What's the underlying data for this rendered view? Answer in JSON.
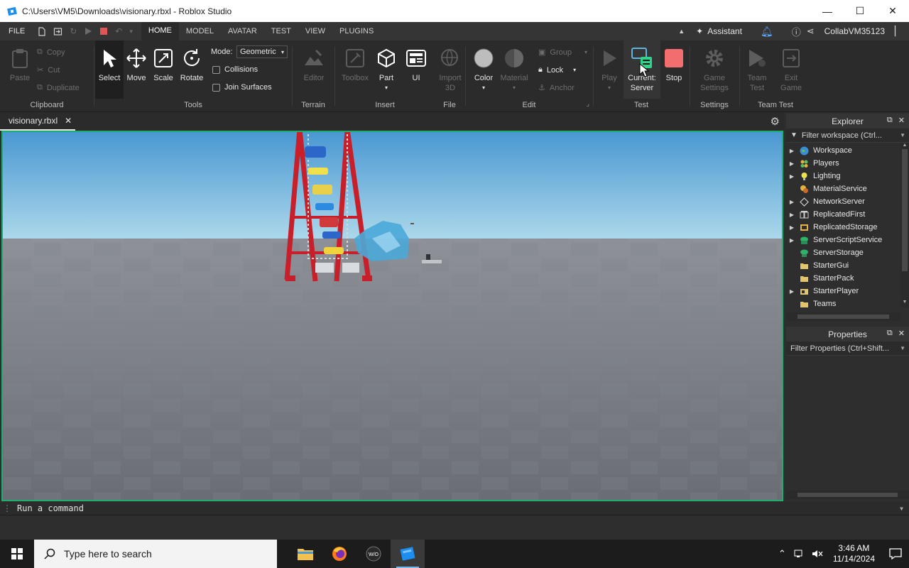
{
  "window": {
    "title": "C:\\Users\\VM5\\Downloads\\visionary.rbxl - Roblox Studio",
    "minimize": "—",
    "maximize": "☐",
    "close": "✕"
  },
  "menu": {
    "file": "FILE",
    "tabs": [
      "HOME",
      "MODEL",
      "AVATAR",
      "TEST",
      "VIEW",
      "PLUGINS"
    ],
    "active_tab": "HOME",
    "assistant": "Assistant",
    "user": "CollabVM35123"
  },
  "ribbon": {
    "clipboard": {
      "label": "Clipboard",
      "paste": "Paste",
      "copy": "Copy",
      "cut": "Cut",
      "duplicate": "Duplicate"
    },
    "tools": {
      "label": "Tools",
      "select": "Select",
      "move": "Move",
      "scale": "Scale",
      "rotate": "Rotate",
      "mode_label": "Mode:",
      "mode_value": "Geometric",
      "collisions": "Collisions",
      "join_surfaces": "Join Surfaces"
    },
    "terrain": {
      "label": "Terrain",
      "editor": "Editor"
    },
    "insert": {
      "label": "Insert",
      "toolbox": "Toolbox",
      "part": "Part",
      "ui": "UI"
    },
    "file": {
      "label": "File",
      "import3d_1": "Import",
      "import3d_2": "3D"
    },
    "edit": {
      "label": "Edit",
      "color": "Color",
      "material": "Material",
      "group": "Group",
      "lock": "Lock",
      "anchor": "Anchor"
    },
    "test": {
      "label": "Test",
      "play": "Play",
      "current_1": "Current:",
      "current_2": "Server",
      "stop": "Stop"
    },
    "settings": {
      "label": "Settings",
      "game_1": "Game",
      "game_2": "Settings"
    },
    "teamtest": {
      "label": "Team Test",
      "team_1": "Team",
      "team_2": "Test",
      "exit_1": "Exit",
      "exit_2": "Game"
    }
  },
  "document": {
    "tab": "visionary.rbxl"
  },
  "explorer": {
    "title": "Explorer",
    "filter": "Filter workspace (Ctrl...",
    "items": [
      {
        "label": "Workspace",
        "expandable": true
      },
      {
        "label": "Players",
        "expandable": true
      },
      {
        "label": "Lighting",
        "expandable": true
      },
      {
        "label": "MaterialService",
        "expandable": false
      },
      {
        "label": "NetworkServer",
        "expandable": true
      },
      {
        "label": "ReplicatedFirst",
        "expandable": true
      },
      {
        "label": "ReplicatedStorage",
        "expandable": true
      },
      {
        "label": "ServerScriptService",
        "expandable": true
      },
      {
        "label": "ServerStorage",
        "expandable": false
      },
      {
        "label": "StarterGui",
        "expandable": false
      },
      {
        "label": "StarterPack",
        "expandable": false
      },
      {
        "label": "StarterPlayer",
        "expandable": true
      },
      {
        "label": "Teams",
        "expandable": false
      }
    ]
  },
  "properties": {
    "title": "Properties",
    "filter": "Filter Properties (Ctrl+Shift..."
  },
  "command": {
    "placeholder": "Run a command"
  },
  "taskbar": {
    "search_placeholder": "Type here to search",
    "time": "3:46 AM",
    "date": "11/14/2024"
  },
  "colors": {
    "viewport_border": "#1fae6c",
    "stop_red": "#f26d6d",
    "accent_blue": "#5aa6ff"
  }
}
